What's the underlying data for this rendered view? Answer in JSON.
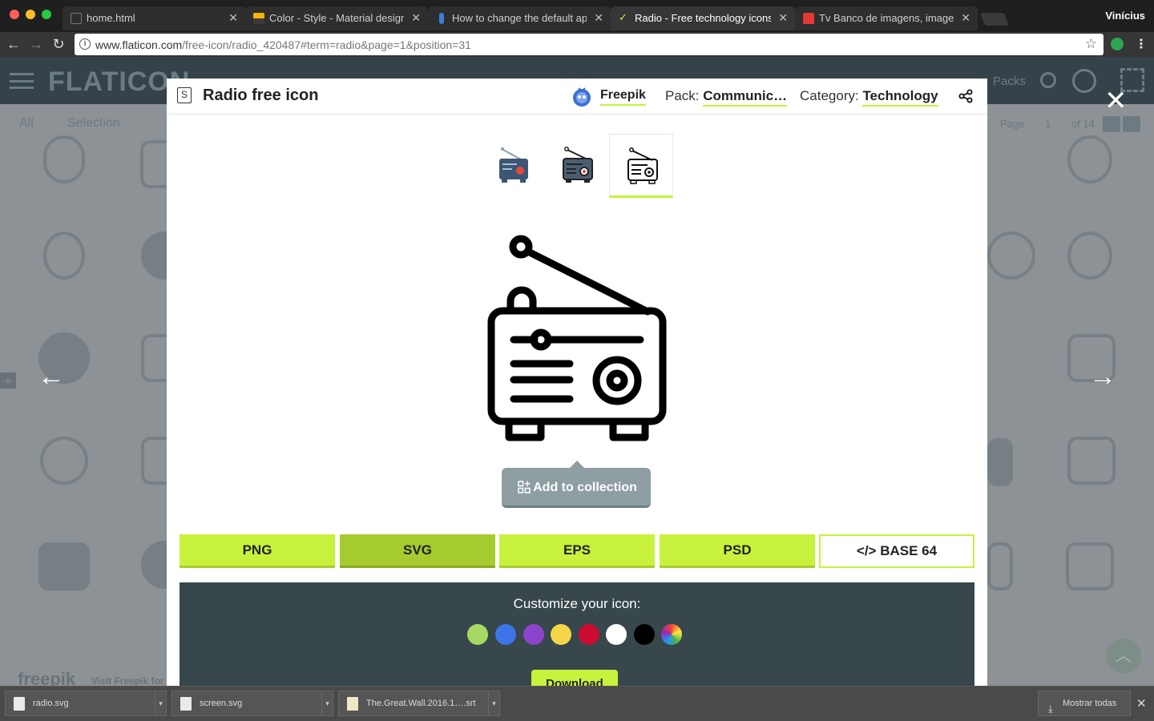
{
  "browser": {
    "tabs": [
      {
        "title": "home.html",
        "favicon_color": "#3a3a3a"
      },
      {
        "title": "Color - Style - Material design",
        "favicon_color": "#f4b400"
      },
      {
        "title": "How to change the default app",
        "favicon_color": "#3b7ddd"
      },
      {
        "title": "Radio - Free technology icons",
        "favicon_color": "#c8f23d"
      },
      {
        "title": "Tv Banco de imagens, imagens",
        "favicon_color": "#e53935"
      }
    ],
    "profile_name": "Vinícius",
    "url_host": "www.flaticon.com",
    "url_path": "/free-icon/radio_420487#term=radio&page=1&position=31"
  },
  "background": {
    "logo": "FLATICON",
    "packs": "Packs",
    "filters": [
      "All",
      "Selection"
    ],
    "page_label": "Page",
    "page_value": "1",
    "page_total": "of 14",
    "footer_brand": "freepik",
    "footer_link": "Visit Freepik for"
  },
  "modal": {
    "title": "Radio free icon",
    "author": "Freepik",
    "pack_label": "Pack:",
    "pack_value": "Communic…",
    "category_label": "Category:",
    "category_value": "Technology",
    "add_collection": "Add to collection",
    "formats": [
      "PNG",
      "SVG",
      "EPS",
      "PSD",
      "</> BASE 64"
    ],
    "customize_title": "Customize your icon:",
    "swatches": [
      "#a6d964",
      "#3d74e8",
      "#8a44cc",
      "#f5d547",
      "#cc0b31",
      "#ffffff",
      "#000000",
      "rainbow"
    ],
    "download": "Download"
  },
  "shelf": {
    "files": [
      "radio.svg",
      "screen.svg",
      "The.Great.Wall.2016.1….srt"
    ],
    "show_all": "Mostrar todas"
  }
}
